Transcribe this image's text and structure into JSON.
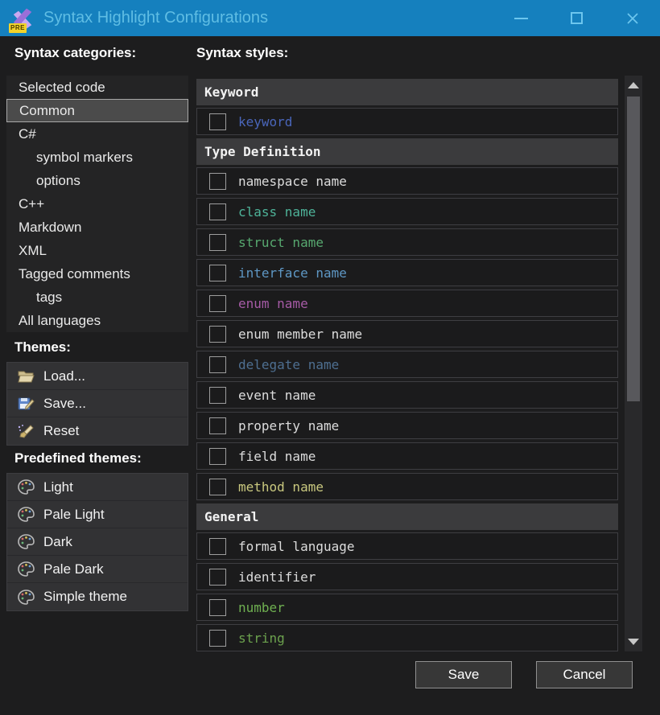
{
  "window": {
    "title": "Syntax Highlight Configurations",
    "icon_badge": "PRE",
    "titlebar_color": "#1580be",
    "title_text_color": "#5fbde4"
  },
  "sidebar": {
    "categories_label": "Syntax categories:",
    "categories": [
      {
        "label": "Selected code",
        "indent": 0,
        "selected": false
      },
      {
        "label": "Common",
        "indent": 0,
        "selected": true
      },
      {
        "label": "C#",
        "indent": 0,
        "selected": false
      },
      {
        "label": "symbol markers",
        "indent": 1,
        "selected": false
      },
      {
        "label": "options",
        "indent": 1,
        "selected": false
      },
      {
        "label": "C++",
        "indent": 0,
        "selected": false
      },
      {
        "label": "Markdown",
        "indent": 0,
        "selected": false
      },
      {
        "label": "XML",
        "indent": 0,
        "selected": false
      },
      {
        "label": "Tagged comments",
        "indent": 0,
        "selected": false
      },
      {
        "label": "tags",
        "indent": 1,
        "selected": false
      },
      {
        "label": "All languages",
        "indent": 0,
        "selected": false
      }
    ],
    "themes_label": "Themes:",
    "theme_actions": [
      {
        "label": "Load...",
        "icon": "folder-open-icon"
      },
      {
        "label": "Save...",
        "icon": "save-icon"
      },
      {
        "label": "Reset",
        "icon": "brush-icon"
      }
    ],
    "predefined_label": "Predefined themes:",
    "predefined_themes": [
      {
        "label": "Light",
        "icon": "palette-icon"
      },
      {
        "label": "Pale Light",
        "icon": "palette-icon"
      },
      {
        "label": "Dark",
        "icon": "palette-icon"
      },
      {
        "label": "Pale Dark",
        "icon": "palette-icon"
      },
      {
        "label": "Simple theme",
        "icon": "palette-icon"
      }
    ]
  },
  "styles_panel": {
    "label": "Syntax styles:",
    "groups": [
      {
        "header": "Keyword",
        "items": [
          {
            "label": "keyword",
            "color": "#4a66bb",
            "checked": false
          }
        ]
      },
      {
        "header": "Type Definition",
        "items": [
          {
            "label": "namespace name",
            "color": "#dcdcdc",
            "checked": false
          },
          {
            "label": "class name",
            "color": "#4eb399",
            "checked": false
          },
          {
            "label": "struct name",
            "color": "#57a86f",
            "checked": false
          },
          {
            "label": "interface name",
            "color": "#5e97c4",
            "checked": false
          },
          {
            "label": "enum name",
            "color": "#a65ba6",
            "checked": false
          },
          {
            "label": "enum member name",
            "color": "#dcdcdc",
            "checked": false
          },
          {
            "label": "delegate name",
            "color": "#4e6f91",
            "checked": false
          },
          {
            "label": "event name",
            "color": "#dcdcdc",
            "checked": false
          },
          {
            "label": "property name",
            "color": "#dcdcdc",
            "checked": false
          },
          {
            "label": "field name",
            "color": "#dcdcdc",
            "checked": false
          },
          {
            "label": "method name",
            "color": "#c9c87f",
            "checked": false
          }
        ]
      },
      {
        "header": "General",
        "items": [
          {
            "label": "formal language",
            "color": "#dcdcdc",
            "checked": false
          },
          {
            "label": "identifier",
            "color": "#dcdcdc",
            "checked": false
          },
          {
            "label": "number",
            "color": "#6fb051",
            "checked": false
          },
          {
            "label": "string",
            "color": "#6ca24e",
            "checked": false
          }
        ]
      }
    ]
  },
  "footer": {
    "save_label": "Save",
    "cancel_label": "Cancel"
  }
}
